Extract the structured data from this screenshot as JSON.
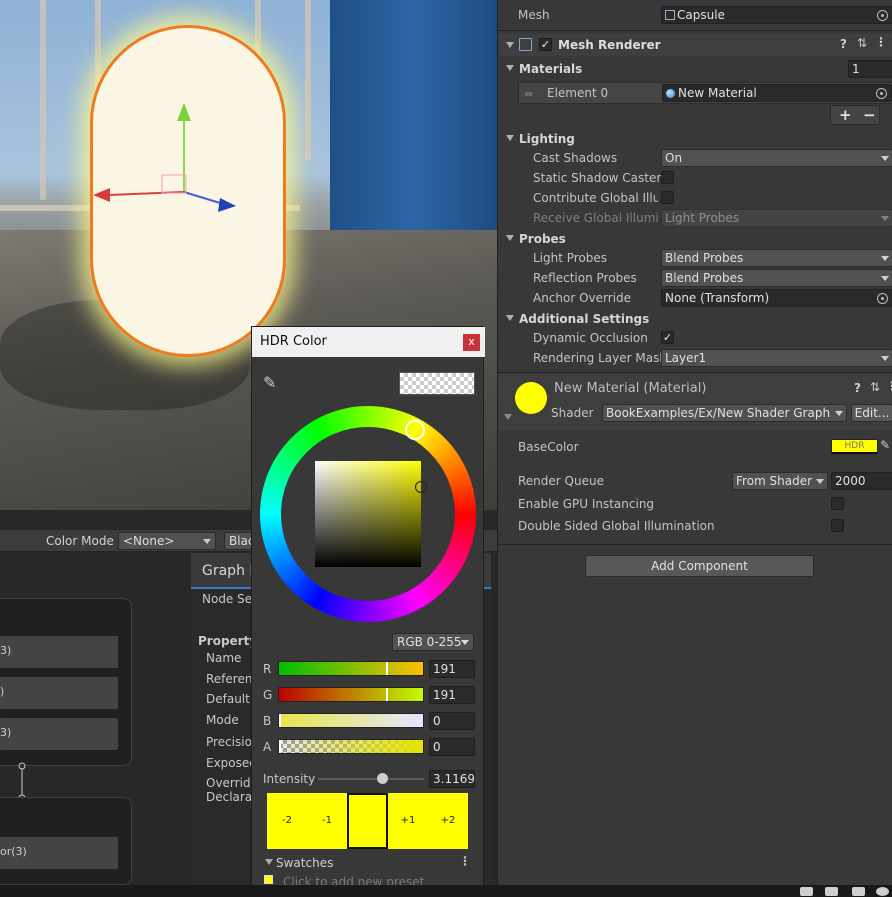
{
  "viewport": {
    "scene_label": "Scene view",
    "capsule": "Capsule object"
  },
  "bottom_panel": {
    "color_mode_label": "Color Mode",
    "color_mode_value": "<None>",
    "black_label": "Black",
    "graph_inspector_title": "Graph I",
    "node_settings_tab": "Node Se",
    "property_heading": "Property",
    "props": [
      "Name",
      "Referen",
      "Default",
      "Mode",
      "Precisio",
      "Exposed",
      "Override",
      "Declara"
    ],
    "node_rows": [
      "3)",
      ")",
      "3)",
      "or(3)"
    ]
  },
  "inspector": {
    "mesh_label": "Mesh",
    "mesh_value": "Capsule",
    "mesh_renderer_title": "Mesh Renderer",
    "materials_label": "Materials",
    "materials_count": "1",
    "element0_label": "Element 0",
    "element0_value": "New Material",
    "plus_label": "+",
    "minus_label": "−",
    "lighting": {
      "title": "Lighting",
      "cast_shadows_label": "Cast Shadows",
      "cast_shadows_value": "On",
      "static_shadow_label": "Static Shadow Caster",
      "contribute_gi_label": "Contribute Global Illum",
      "receive_gi_label": "Receive Global Illumin",
      "receive_gi_value": "Light Probes"
    },
    "probes": {
      "title": "Probes",
      "light_probes_label": "Light Probes",
      "light_probes_value": "Blend Probes",
      "reflection_label": "Reflection Probes",
      "reflection_value": "Blend Probes",
      "anchor_label": "Anchor Override",
      "anchor_value": "None (Transform)"
    },
    "additional": {
      "title": "Additional Settings",
      "dynamic_occlusion_label": "Dynamic Occlusion",
      "rendering_layer_label": "Rendering Layer Mask",
      "rendering_layer_value": "Layer1"
    },
    "material": {
      "title": "New Material (Material)",
      "shader_label": "Shader",
      "shader_value": "BookExamples/Ex/New Shader Graph",
      "edit_label": "Edit...",
      "base_color_label": "BaseColor",
      "hdr_label": "HDR",
      "render_queue_label": "Render Queue",
      "render_queue_mode": "From Shader",
      "render_queue_value": "2000",
      "gpu_instancing_label": "Enable GPU Instancing",
      "double_sided_label": "Double Sided Global Illumination"
    },
    "add_component_label": "Add Component"
  },
  "color_picker": {
    "title": "HDR Color",
    "close_label": "x",
    "mode": "RGB 0-255",
    "channels": [
      {
        "label": "R",
        "value": "191",
        "fill": 0.75
      },
      {
        "label": "G",
        "value": "191",
        "fill": 0.75
      },
      {
        "label": "B",
        "value": "0",
        "fill": 0.0
      },
      {
        "label": "A",
        "value": "0",
        "fill": 0.0
      }
    ],
    "intensity_label": "Intensity",
    "intensity_value": "3.11692",
    "intensity_fill": 0.6,
    "presets": [
      "-2",
      "-1",
      "",
      "+1",
      "+2"
    ],
    "swatches_label": "Swatches",
    "add_preset_hint": "Click to add new preset",
    "accent_color": "#ffff00"
  }
}
